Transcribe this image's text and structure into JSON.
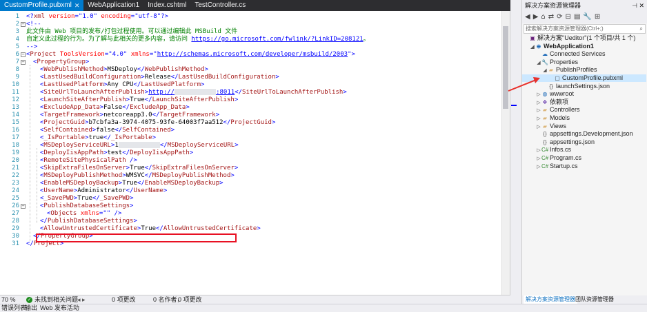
{
  "tabs": [
    {
      "label": "CustomProfile.pubxml",
      "active": true
    },
    {
      "label": "WebApplication1",
      "active": false
    },
    {
      "label": "Index.cshtml",
      "active": false
    },
    {
      "label": "TestController.cs",
      "active": false
    }
  ],
  "code": {
    "lines": [
      {
        "n": "1",
        "parts": [
          [
            "br",
            "<?"
          ],
          [
            "tg",
            "xml"
          ],
          [
            "at",
            " version"
          ],
          [
            "br",
            "=\""
          ],
          [
            "av",
            "1.0"
          ],
          [
            "br",
            "\""
          ],
          [
            "at",
            " encoding"
          ],
          [
            "br",
            "=\""
          ],
          [
            "av",
            "utf-8"
          ],
          [
            "br",
            "\"?>"
          ]
        ]
      },
      {
        "n": "2",
        "parts": [
          [
            "br",
            "<!--"
          ]
        ]
      },
      {
        "n": "3",
        "parts": [
          [
            "cm",
            "此文件由 Web 项目的发布/打包过程使用。可以通过编辑此 MSBuild 文件"
          ]
        ]
      },
      {
        "n": "4",
        "parts": [
          [
            "cm",
            "自定义此过程的行为。为了解与此相关的更多内容，请访问 "
          ],
          [
            "url",
            "https://go.microsoft.com/fwlink/?LinkID=208121"
          ],
          [
            "cm",
            "。"
          ]
        ]
      },
      {
        "n": "5",
        "parts": [
          [
            "br",
            "-->"
          ]
        ]
      },
      {
        "n": "6",
        "parts": [
          [
            "br",
            "<"
          ],
          [
            "tg",
            "Project"
          ],
          [
            "at",
            " ToolsVersion"
          ],
          [
            "br",
            "=\""
          ],
          [
            "av",
            "4.0"
          ],
          [
            "br",
            "\""
          ],
          [
            "at",
            " xmlns"
          ],
          [
            "br",
            "=\""
          ],
          [
            "url",
            "http://schemas.microsoft.com/developer/msbuild/2003"
          ],
          [
            "br",
            "\">"
          ]
        ]
      },
      {
        "n": "7",
        "indent": 1,
        "parts": [
          [
            "br",
            "<"
          ],
          [
            "tg",
            "PropertyGroup"
          ],
          [
            "br",
            ">"
          ]
        ]
      },
      {
        "n": "8",
        "indent": 2,
        "parts": [
          [
            "br",
            "<"
          ],
          [
            "tg",
            "WebPublishMethod"
          ],
          [
            "br",
            ">"
          ],
          [
            "",
            "MSDeploy"
          ],
          [
            "br",
            "</"
          ],
          [
            "tg",
            "WebPublishMethod"
          ],
          [
            "br",
            ">"
          ]
        ]
      },
      {
        "n": "9",
        "indent": 2,
        "parts": [
          [
            "br",
            "<"
          ],
          [
            "tg",
            "LastUsedBuildConfiguration"
          ],
          [
            "br",
            ">"
          ],
          [
            "",
            "Release"
          ],
          [
            "br",
            "</"
          ],
          [
            "tg",
            "LastUsedBuildConfiguration"
          ],
          [
            "br",
            ">"
          ]
        ]
      },
      {
        "n": "10",
        "indent": 2,
        "parts": [
          [
            "br",
            "<"
          ],
          [
            "tg",
            "LastUsedPlatform"
          ],
          [
            "br",
            ">"
          ],
          [
            "",
            "Any CPU"
          ],
          [
            "br",
            "</"
          ],
          [
            "tg",
            "LastUsedPlatform"
          ],
          [
            "br",
            ">"
          ]
        ]
      },
      {
        "n": "11",
        "indent": 2,
        "parts": [
          [
            "br",
            "<"
          ],
          [
            "tg",
            "SiteUrlToLaunchAfterPublish"
          ],
          [
            "br",
            ">"
          ],
          [
            "url",
            "http://"
          ],
          [
            "blur",
            ""
          ],
          [
            "url",
            ":8011"
          ],
          [
            "br",
            "</"
          ],
          [
            "tg",
            "SiteUrlToLaunchAfterPublish"
          ],
          [
            "br",
            ">"
          ]
        ]
      },
      {
        "n": "12",
        "indent": 2,
        "parts": [
          [
            "br",
            "<"
          ],
          [
            "tg",
            "LaunchSiteAfterPublish"
          ],
          [
            "br",
            ">"
          ],
          [
            "",
            "True"
          ],
          [
            "br",
            "</"
          ],
          [
            "tg",
            "LaunchSiteAfterPublish"
          ],
          [
            "br",
            ">"
          ]
        ]
      },
      {
        "n": "13",
        "indent": 2,
        "parts": [
          [
            "br",
            "<"
          ],
          [
            "tg",
            "ExcludeApp_Data"
          ],
          [
            "br",
            ">"
          ],
          [
            "",
            "False"
          ],
          [
            "br",
            "</"
          ],
          [
            "tg",
            "ExcludeApp_Data"
          ],
          [
            "br",
            ">"
          ]
        ]
      },
      {
        "n": "14",
        "indent": 2,
        "parts": [
          [
            "br",
            "<"
          ],
          [
            "tg",
            "TargetFramework"
          ],
          [
            "br",
            ">"
          ],
          [
            "",
            "netcoreapp3.0"
          ],
          [
            "br",
            "</"
          ],
          [
            "tg",
            "TargetFramework"
          ],
          [
            "br",
            ">"
          ]
        ]
      },
      {
        "n": "15",
        "indent": 2,
        "parts": [
          [
            "br",
            "<"
          ],
          [
            "tg",
            "ProjectGuid"
          ],
          [
            "br",
            ">"
          ],
          [
            "",
            "b7cbfa3a-3974-4075-93fe-64003f7aa512"
          ],
          [
            "br",
            "</"
          ],
          [
            "tg",
            "ProjectGuid"
          ],
          [
            "br",
            ">"
          ]
        ]
      },
      {
        "n": "16",
        "indent": 2,
        "parts": [
          [
            "br",
            "<"
          ],
          [
            "tg",
            "SelfContained"
          ],
          [
            "br",
            ">"
          ],
          [
            "",
            "false"
          ],
          [
            "br",
            "</"
          ],
          [
            "tg",
            "SelfContained"
          ],
          [
            "br",
            ">"
          ]
        ]
      },
      {
        "n": "17",
        "indent": 2,
        "parts": [
          [
            "br",
            "<"
          ],
          [
            "tg",
            "_IsPortable"
          ],
          [
            "br",
            ">"
          ],
          [
            "",
            "true"
          ],
          [
            "br",
            "</"
          ],
          [
            "tg",
            "_IsPortable"
          ],
          [
            "br",
            ">"
          ]
        ]
      },
      {
        "n": "18",
        "indent": 2,
        "parts": [
          [
            "br",
            "<"
          ],
          [
            "tg",
            "MSDeployServiceURL"
          ],
          [
            "br",
            ">"
          ],
          [
            "",
            "1"
          ],
          [
            "blur",
            ""
          ],
          [
            "br",
            "</"
          ],
          [
            "tg",
            "MSDeployServiceURL"
          ],
          [
            "br",
            ">"
          ]
        ]
      },
      {
        "n": "19",
        "indent": 2,
        "parts": [
          [
            "br",
            "<"
          ],
          [
            "tg",
            "DeployIisAppPath"
          ],
          [
            "br",
            ">"
          ],
          [
            "",
            "test"
          ],
          [
            "br",
            "</"
          ],
          [
            "tg",
            "DeployIisAppPath"
          ],
          [
            "br",
            ">"
          ]
        ]
      },
      {
        "n": "20",
        "indent": 2,
        "parts": [
          [
            "br",
            "<"
          ],
          [
            "tg",
            "RemoteSitePhysicalPath"
          ],
          [
            "br",
            " />"
          ]
        ]
      },
      {
        "n": "21",
        "indent": 2,
        "parts": [
          [
            "br",
            "<"
          ],
          [
            "tg",
            "SkipExtraFilesOnServer"
          ],
          [
            "br",
            ">"
          ],
          [
            "",
            "True"
          ],
          [
            "br",
            "</"
          ],
          [
            "tg",
            "SkipExtraFilesOnServer"
          ],
          [
            "br",
            ">"
          ]
        ]
      },
      {
        "n": "22",
        "indent": 2,
        "parts": [
          [
            "br",
            "<"
          ],
          [
            "tg",
            "MSDeployPublishMethod"
          ],
          [
            "br",
            ">"
          ],
          [
            "",
            "WMSVC"
          ],
          [
            "br",
            "</"
          ],
          [
            "tg",
            "MSDeployPublishMethod"
          ],
          [
            "br",
            ">"
          ]
        ]
      },
      {
        "n": "23",
        "indent": 2,
        "parts": [
          [
            "br",
            "<"
          ],
          [
            "tg",
            "EnableMSDeployBackup"
          ],
          [
            "br",
            ">"
          ],
          [
            "",
            "True"
          ],
          [
            "br",
            "</"
          ],
          [
            "tg",
            "EnableMSDeployBackup"
          ],
          [
            "br",
            ">"
          ]
        ]
      },
      {
        "n": "24",
        "indent": 2,
        "parts": [
          [
            "br",
            "<"
          ],
          [
            "tg",
            "UserName"
          ],
          [
            "br",
            ">"
          ],
          [
            "",
            "Administrator"
          ],
          [
            "br",
            "</"
          ],
          [
            "tg",
            "UserName"
          ],
          [
            "br",
            ">"
          ]
        ]
      },
      {
        "n": "25",
        "indent": 2,
        "parts": [
          [
            "br",
            "<"
          ],
          [
            "tg",
            "_SavePWD"
          ],
          [
            "br",
            ">"
          ],
          [
            "",
            "True"
          ],
          [
            "br",
            "</"
          ],
          [
            "tg",
            "_SavePWD"
          ],
          [
            "br",
            ">"
          ]
        ]
      },
      {
        "n": "26",
        "indent": 2,
        "parts": [
          [
            "br",
            "<"
          ],
          [
            "tg",
            "PublishDatabaseSettings"
          ],
          [
            "br",
            ">"
          ]
        ]
      },
      {
        "n": "27",
        "indent": 3,
        "parts": [
          [
            "br",
            "<"
          ],
          [
            "tg",
            "Objects"
          ],
          [
            "at",
            " xmlns"
          ],
          [
            "br",
            "=\""
          ],
          [
            "br",
            "\" />"
          ]
        ]
      },
      {
        "n": "28",
        "indent": 2,
        "parts": [
          [
            "br",
            "</"
          ],
          [
            "tg",
            "PublishDatabaseSettings"
          ],
          [
            "br",
            ">"
          ]
        ]
      },
      {
        "n": "29",
        "indent": 2,
        "parts": [
          [
            "br",
            "<"
          ],
          [
            "tg",
            "AllowUntrustedCertificate"
          ],
          [
            "br",
            ">"
          ],
          [
            "",
            "True"
          ],
          [
            "br",
            "</"
          ],
          [
            "tg",
            "AllowUntrustedCertificate"
          ],
          [
            "br",
            ">"
          ]
        ]
      },
      {
        "n": "30",
        "indent": 1,
        "parts": [
          [
            "br",
            "</"
          ],
          [
            "tg",
            "PropertyGroup"
          ],
          [
            "br",
            ">"
          ]
        ]
      },
      {
        "n": "31",
        "indent": 0,
        "parts": [
          [
            "br",
            "</"
          ],
          [
            "tg",
            "Project"
          ],
          [
            "br",
            ">"
          ]
        ]
      }
    ]
  },
  "editor_status": {
    "zoom": "70 %",
    "issues": "未找到相关问题",
    "changes": "0 项更改",
    "authors": "0 名作者，",
    "changes2": "0 项更改"
  },
  "bottom_bar": {
    "errors": "错误列表",
    "output": "输出",
    "publish": "Web 发布活动"
  },
  "solution_explorer": {
    "title": "解决方案资源管理器",
    "search_placeholder": "搜索解决方案资源管理器(Ctrl+;)",
    "tree": [
      {
        "label": "解决方案\"Ueditor\"(1 个项目/共 1 个)",
        "depth": 0,
        "arrow": "",
        "icon": "sln-icon"
      },
      {
        "label": "WebApplication1",
        "depth": 1,
        "arrow": "down",
        "icon": "web-project-icon",
        "bold": true
      },
      {
        "label": "Connected Services",
        "depth": 2,
        "arrow": "",
        "icon": "connected-services-icon"
      },
      {
        "label": "Properties",
        "depth": 2,
        "arrow": "down",
        "icon": "wrench-icon"
      },
      {
        "label": "PublishProfiles",
        "depth": 3,
        "arrow": "down",
        "icon": "folder-icon"
      },
      {
        "label": "CustomProfile.pubxml",
        "depth": 4,
        "arrow": "",
        "icon": "file-icon",
        "selected": true
      },
      {
        "label": "launchSettings.json",
        "depth": 3,
        "arrow": "",
        "icon": "json-icon"
      },
      {
        "label": "wwwroot",
        "depth": 2,
        "arrow": "right",
        "icon": "globe-icon"
      },
      {
        "label": "依赖项",
        "depth": 2,
        "arrow": "right",
        "icon": "dependencies-icon"
      },
      {
        "label": "Controllers",
        "depth": 2,
        "arrow": "right",
        "icon": "folder-icon"
      },
      {
        "label": "Models",
        "depth": 2,
        "arrow": "right",
        "icon": "folder-icon"
      },
      {
        "label": "Views",
        "depth": 2,
        "arrow": "right",
        "icon": "folder-icon"
      },
      {
        "label": "appsettings.Development.json",
        "depth": 2,
        "arrow": "",
        "icon": "json-icon"
      },
      {
        "label": "appsettings.json",
        "depth": 2,
        "arrow": "",
        "icon": "json-icon"
      },
      {
        "label": "Infos.cs",
        "depth": 2,
        "arrow": "right",
        "icon": "csharp-icon"
      },
      {
        "label": "Program.cs",
        "depth": 2,
        "arrow": "right",
        "icon": "csharp-icon"
      },
      {
        "label": "Startup.cs",
        "depth": 2,
        "arrow": "right",
        "icon": "csharp-icon"
      }
    ],
    "bottom_tabs": [
      "解决方案资源管理器",
      "团队资源管理器"
    ]
  },
  "colors": {
    "tab_active": "#007acc",
    "highlight_box": "#e81123",
    "annotation_arrow": "#e8312b",
    "selected_item": "#cce8ff"
  }
}
